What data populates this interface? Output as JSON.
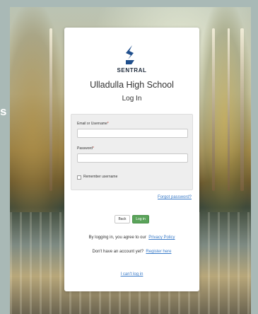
{
  "background": {
    "side_char": "s"
  },
  "brand": {
    "name": "SENTRAL",
    "logo_color": "#1f4e8c"
  },
  "school": {
    "name": "Ulladulla High School"
  },
  "page": {
    "title": "Log In"
  },
  "form": {
    "email_label": "Email or Username",
    "password_label": "Password",
    "required_mark": "*",
    "email_value": "",
    "password_value": "",
    "remember_label": "Remember username",
    "remember_checked": false
  },
  "links": {
    "forgot": "Forgot password?",
    "agree_prefix": "By logging in, you agree to our",
    "privacy": "Privacy Policy",
    "no_account_prefix": "Don't have an account yet?",
    "register": "Register here",
    "cant_login": "I can't log in"
  },
  "buttons": {
    "back": "Back",
    "login": "Log in"
  },
  "colors": {
    "login_button": "#5aa35a",
    "link": "#3a7bc8"
  }
}
